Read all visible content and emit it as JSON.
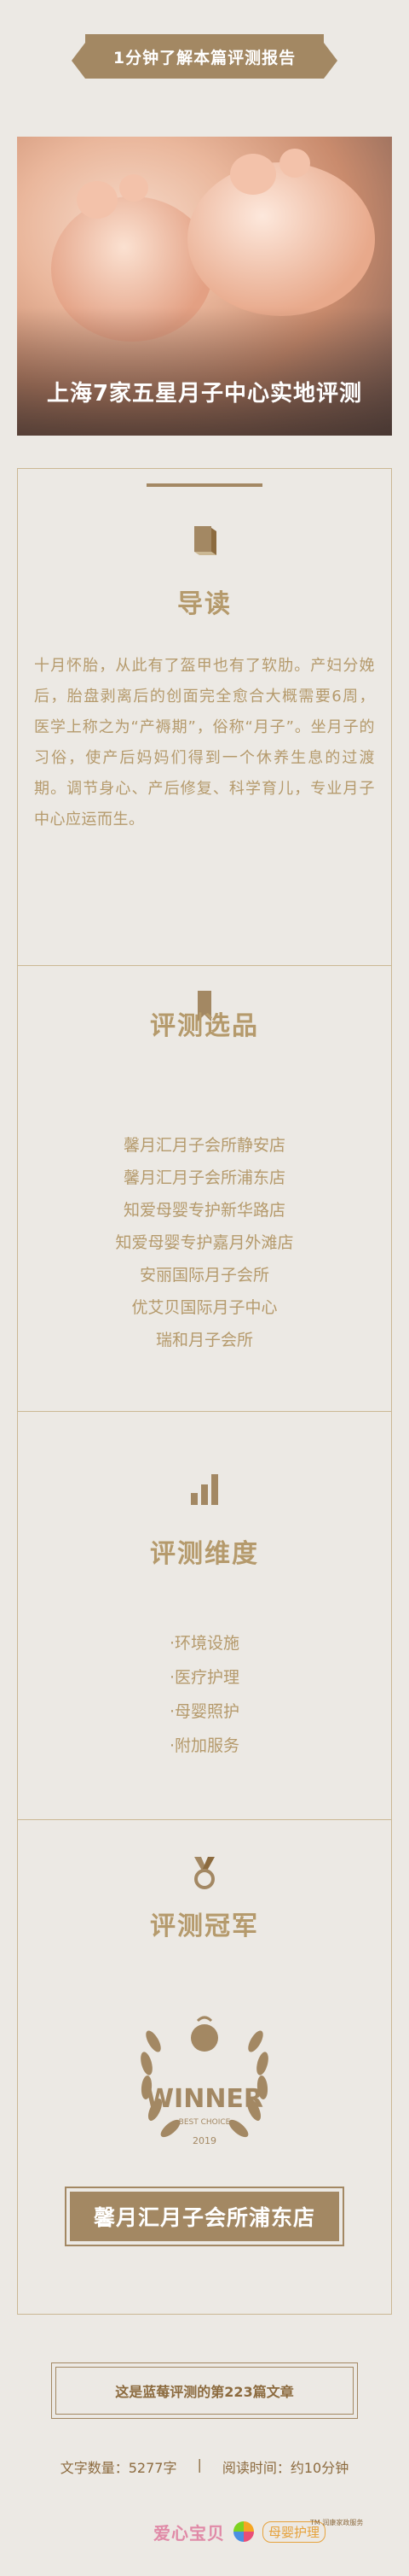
{
  "banner": {
    "label": "1分钟了解本篇评测报告"
  },
  "hero": {
    "title": "上海7家五星月子中心实地评测"
  },
  "intro": {
    "title": "导读",
    "body": "十月怀胎，从此有了盔甲也有了软肋。产妇分娩后，胎盘剥离后的创面完全愈合大概需要6周，医学上称之为“产褥期”，俗称“月子”。坐月子的习俗，使产后妈妈们得到一个休养生息的过渡期。调节身心、产后修复、科学育儿，专业月子中心应运而生。"
  },
  "selection": {
    "title": "评测选品",
    "items": [
      "馨月汇月子会所静安店",
      "馨月汇月子会所浦东店",
      "知爱母婴专护新华路店",
      "知爱母婴专护嘉月外滩店",
      "安丽国际月子会所",
      "优艾贝国际月子中心",
      "瑞和月子会所"
    ]
  },
  "dimensions": {
    "title": "评测维度",
    "items": [
      "·环境设施",
      "·医疗护理",
      "·母婴照护",
      "·附加服务"
    ]
  },
  "champion": {
    "title": "评测冠军",
    "badge": {
      "word": "WINNER",
      "sub": "BEST CHOICE",
      "year": "2019"
    },
    "name": "馨月汇月子会所浦东店"
  },
  "footer": {
    "article": "这是蓝莓评测的第223篇文章",
    "word_count": "文字数量：5277字",
    "separator": "|",
    "read_time": "阅读时间：约10分钟",
    "brand_left": "爱心宝贝",
    "brand_right": "母婴护理",
    "brand_tiny": "TM 润康家政服务"
  },
  "colors": {
    "accent": "#a38863",
    "text": "#b59a6c",
    "background": "#ece9e4"
  },
  "icons": [
    "book-icon",
    "bookmark-icon",
    "bar-chart-icon",
    "medal-icon",
    "laurel-wreath-icon"
  ]
}
